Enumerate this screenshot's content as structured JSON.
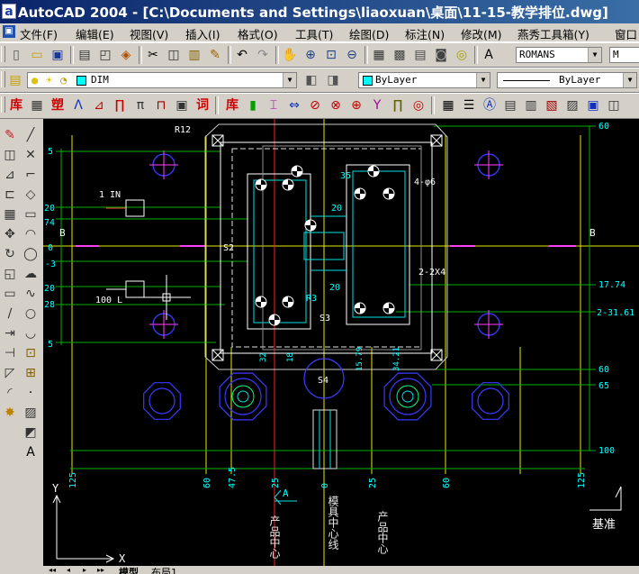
{
  "window": {
    "title": "AutoCAD 2004 - [C:\\Documents and Settings\\liaoxuan\\桌面\\11-15-教学排位.dwg]"
  },
  "menu": {
    "items": [
      "文件(F)",
      "编辑(E)",
      "视图(V)",
      "插入(I)",
      "格式(O)",
      "工具(T)",
      "绘图(D)",
      "标注(N)",
      "修改(M)",
      "燕秀工具箱(Y)",
      "窗口"
    ]
  },
  "standard_toolbar": {
    "groups": [
      [
        "new-icon",
        "open-icon",
        "save-icon"
      ],
      [
        "print-icon",
        "plot-preview-icon",
        "publish-icon"
      ],
      [
        "cut-icon",
        "copy-clip-icon",
        "paste-icon",
        "match-properties-icon"
      ],
      [
        "undo-icon",
        "redo-icon"
      ],
      [
        "pan-icon",
        "zoom-realtime-icon",
        "zoom-window-icon",
        "zoom-previous-icon"
      ],
      [
        "properties-icon",
        "design-center-icon",
        "tool-palettes-icon",
        "dbconnect-icon",
        "markup-icon"
      ],
      [
        "text-style-icon"
      ]
    ]
  },
  "styles_toolbar": {
    "text_style": "ROMANS",
    "next_style": "M"
  },
  "layers_toolbar": {
    "current_layer": "DIM",
    "layer_color": "#00ffff",
    "layer_state_icons": [
      "bulb-on-icon",
      "sun-thaw-icon",
      "lock-open-icon"
    ],
    "buttons": [
      "layer-manager-icon",
      "layer-previous-icon",
      "make-current-icon"
    ]
  },
  "properties_toolbar": {
    "color": "ByLayer",
    "color_swatch": "#00ffff",
    "linetype": "ByLayer"
  },
  "yanxiu_toolbar": {
    "groups": [
      [
        "lib-icon",
        "table-icon",
        "plastic-icon",
        "angle-icon",
        "dimension-icon",
        "screw-icon",
        "pin-icon",
        "block-icon",
        "plot-icon",
        "word-icon"
      ],
      [
        "lib2-icon",
        "thermometer-icon",
        "spring-icon",
        "width-icon",
        "cross-cut-icon",
        "bolt-icon",
        "center-icon",
        "y-icon",
        "door-icon",
        "target-icon"
      ],
      [
        "grid-icon",
        "list-icon",
        "a2-icon",
        "table2-icon",
        "table3-icon",
        "table4-icon",
        "chart-icon",
        "box-icon",
        "extra-icon"
      ]
    ],
    "labels": {
      "lib-icon": "库",
      "plastic-icon": "塑",
      "word-icon": "词",
      "lib2-icon": "库"
    }
  },
  "modify_toolbar": {
    "items": [
      "erase-icon",
      "copy-icon",
      "mirror-icon",
      "offset-icon",
      "array-icon",
      "move-icon",
      "rotate-icon",
      "scale-icon",
      "stretch-icon",
      "trim-icon",
      "extend-icon",
      "break-icon",
      "chamfer-icon",
      "fillet-icon",
      "explode-icon"
    ]
  },
  "draw_toolbar": {
    "items": [
      "line-icon",
      "construction-line-icon",
      "polyline-icon",
      "polygon-icon",
      "rectangle-icon",
      "arc-icon",
      "circle-icon",
      "revcloud-icon",
      "spline-icon",
      "ellipse-icon",
      "ellipse-arc-icon",
      "insert-block-icon",
      "make-block-icon",
      "point-icon",
      "hatch-icon",
      "region-icon",
      "multiline-text-icon"
    ]
  },
  "drawing": {
    "left_dims": [
      "5",
      "20",
      "74",
      "0",
      "-3",
      "20",
      "28",
      "5"
    ],
    "left_notes": [
      "1 IN",
      "100 L"
    ],
    "section_marks": [
      "B",
      "B"
    ],
    "right_dims": [
      "60",
      "17.74",
      "2-31.61",
      "60",
      "65",
      "100"
    ],
    "bottom_dims": [
      "125",
      "60",
      "47.5",
      "25",
      "0",
      "25",
      "60",
      "125"
    ],
    "inner_dims": [
      "32",
      "18",
      "15.79",
      "34.21"
    ],
    "callouts": [
      "R12",
      "4-φ6",
      "2-2X4",
      "S3",
      "S2",
      "S4",
      "35",
      "20",
      "20",
      "R3",
      "A"
    ],
    "center_labels": [
      "产品中心",
      "模具中心线",
      "产品中心"
    ],
    "datum": "基准",
    "ucs": {
      "y": "Y",
      "x": "X"
    }
  },
  "layout_tabs": [
    "模型",
    "布局1"
  ],
  "colors": {
    "title_bar": "#0a246a",
    "canvas": "#000000",
    "dim_text": "#00ffff",
    "center_line": "#ffff00",
    "product_center": "#ff0000"
  }
}
